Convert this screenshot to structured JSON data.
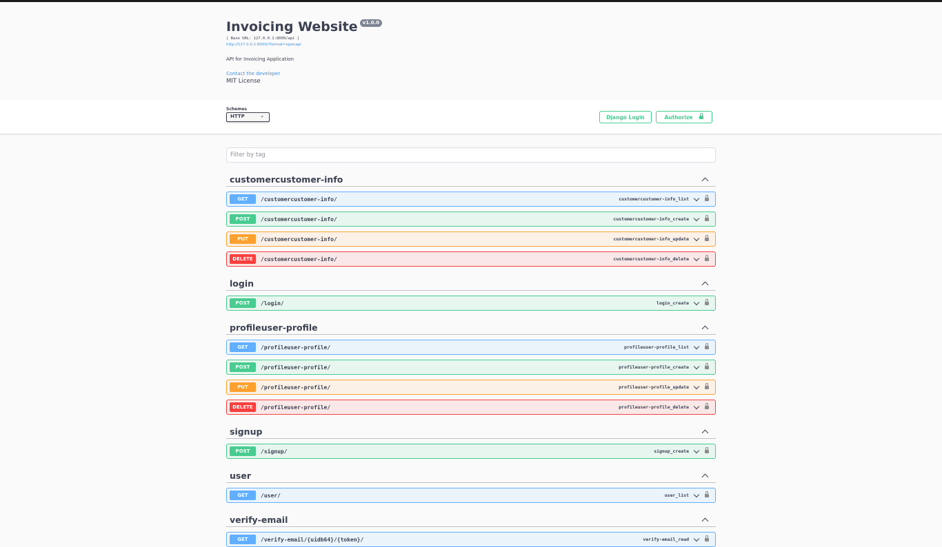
{
  "info": {
    "title": "Invoicing Website",
    "version": "v1.0.0",
    "base_url": "[ Base URL: 127.0.0.1:8000/api ]",
    "spec_link": "http://127.0.0.1:8000/?format=openapi",
    "description": "API for Invoicing Application",
    "contact": "Contact the developer",
    "license": "MIT License"
  },
  "schemes": {
    "label": "Schemes",
    "selected": "HTTP"
  },
  "buttons": {
    "django_login": "Django Login",
    "authorize": "Authorize"
  },
  "filter": {
    "placeholder": "Filter by tag"
  },
  "tags": [
    {
      "name": "customercustomer-info",
      "ops": [
        {
          "method": "GET",
          "path": "/customercustomer-info/",
          "id": "customercustomer-info_list"
        },
        {
          "method": "POST",
          "path": "/customercustomer-info/",
          "id": "customercustomer-info_create"
        },
        {
          "method": "PUT",
          "path": "/customercustomer-info/",
          "id": "customercustomer-info_update"
        },
        {
          "method": "DELETE",
          "path": "/customercustomer-info/",
          "id": "customercustomer-info_delete"
        }
      ]
    },
    {
      "name": "login",
      "ops": [
        {
          "method": "POST",
          "path": "/login/",
          "id": "login_create"
        }
      ]
    },
    {
      "name": "profileuser-profile",
      "ops": [
        {
          "method": "GET",
          "path": "/profileuser-profile/",
          "id": "profileuser-profile_list"
        },
        {
          "method": "POST",
          "path": "/profileuser-profile/",
          "id": "profileuser-profile_create"
        },
        {
          "method": "PUT",
          "path": "/profileuser-profile/",
          "id": "profileuser-profile_update"
        },
        {
          "method": "DELETE",
          "path": "/profileuser-profile/",
          "id": "profileuser-profile_delete"
        }
      ]
    },
    {
      "name": "signup",
      "ops": [
        {
          "method": "POST",
          "path": "/signup/",
          "id": "signup_create"
        }
      ]
    },
    {
      "name": "user",
      "ops": [
        {
          "method": "GET",
          "path": "/user/",
          "id": "user_list"
        }
      ]
    },
    {
      "name": "verify-email",
      "ops": [
        {
          "method": "GET",
          "path": "/verify-email/{uidb64}/{token}/",
          "id": "verify-email_read"
        }
      ]
    }
  ]
}
